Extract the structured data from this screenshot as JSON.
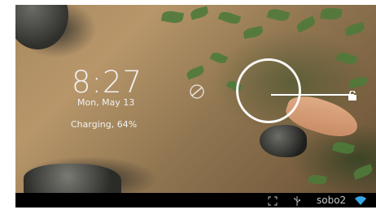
{
  "lockscreen": {
    "time": "8:27",
    "date": "Mon, May 13",
    "charging": "Charging, 64%"
  },
  "statusbar": {
    "label": "sobo2",
    "icons": [
      "screenshot-icon",
      "usb-icon",
      "wifi-icon"
    ]
  },
  "colors": {
    "status_icon": "#9aa4ad",
    "wifi": "#35a7e8"
  }
}
